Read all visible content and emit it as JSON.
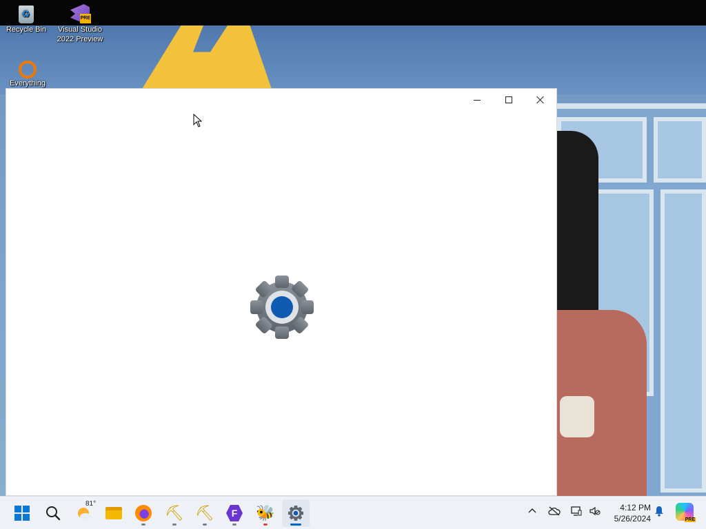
{
  "desktop": {
    "icons": [
      {
        "label": "Recycle Bin",
        "icon": "recycle-bin-icon"
      },
      {
        "label": "Visual Studio 2022 Preview",
        "badge": "PRE",
        "icon": "visual-studio-icon"
      },
      {
        "label": "Everything",
        "icon": "everything-search-icon"
      }
    ]
  },
  "window": {
    "title": "",
    "controls": [
      "minimize",
      "maximize",
      "close"
    ],
    "splash_icon": "settings-gear-icon",
    "colors": {
      "gear": "#6b737c",
      "center": "#0f5ab3",
      "ring": "#d9dde2"
    }
  },
  "taskbar": {
    "weather_temp": "81°",
    "apps": [
      "start",
      "search",
      "weather",
      "file-explorer",
      "firefox",
      "tool-1",
      "tool-2",
      "app-purple",
      "bee-app",
      "settings"
    ],
    "active_app": "settings",
    "clock": {
      "time": "4:12 PM",
      "date": "5/26/2024"
    },
    "copilot_badge": "PRE",
    "accent": "#0067c0"
  }
}
